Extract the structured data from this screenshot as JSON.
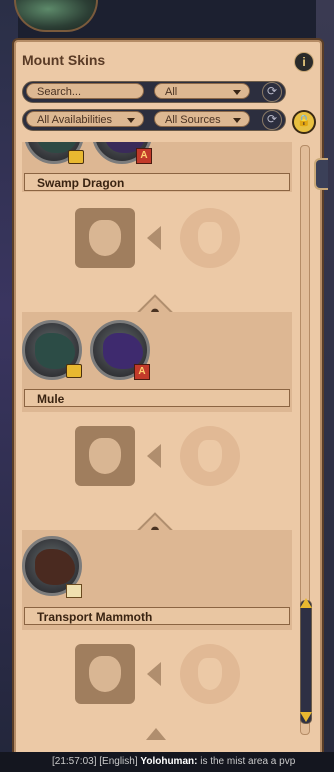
{
  "panel": {
    "title": "Mount Skins",
    "info_icon": "info-icon",
    "lock_icon": "lock-icon"
  },
  "filters": {
    "search_placeholder": "Search...",
    "category_value": "All",
    "availability_value": "All Availabilities",
    "sources_value": "All Sources"
  },
  "entries": [
    {
      "name": "Swamp Dragon",
      "badges": [
        "lock",
        "a"
      ]
    },
    {
      "name": "Mule",
      "badges": [
        "lock",
        "a"
      ]
    },
    {
      "name": "Transport Mammoth",
      "badges": [
        "calendar"
      ]
    }
  ],
  "chat": {
    "timestamp": "[21:57:03]",
    "channel": "[English]",
    "user": "Yolohuman:",
    "message": "is the mist area a pvp"
  },
  "colors": {
    "panel": "#ecc9a6",
    "accent_gold": "#e8b830",
    "text_brown": "#5a3b26"
  }
}
